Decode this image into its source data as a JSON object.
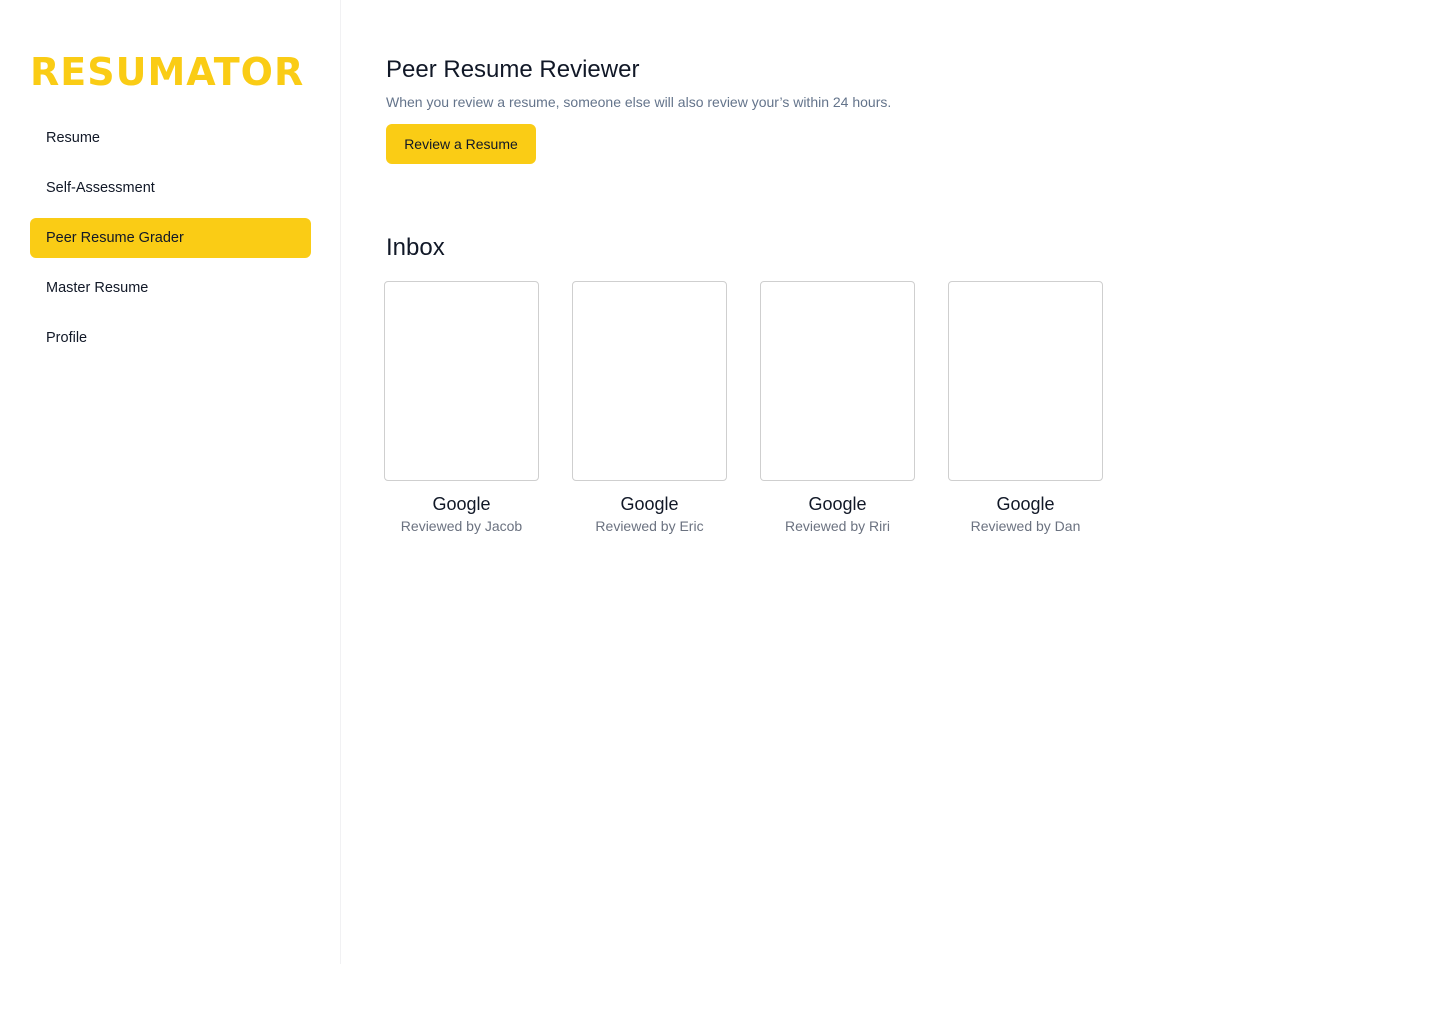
{
  "brand": {
    "logo_text": "RESUMATOR",
    "accent_color": "#facc15"
  },
  "sidebar": {
    "items": [
      {
        "label": "Resume",
        "active": false
      },
      {
        "label": "Self-Assessment",
        "active": false
      },
      {
        "label": "Peer Resume Grader",
        "active": true
      },
      {
        "label": "Master Resume",
        "active": false
      },
      {
        "label": "Profile",
        "active": false
      }
    ]
  },
  "header": {
    "title": "Peer Resume Reviewer",
    "subtitle": "When you review a resume, someone else will also review your’s within 24 hours.",
    "action_label": "Review a Resume"
  },
  "inbox": {
    "title": "Inbox",
    "cards": [
      {
        "company": "Google",
        "reviewer": "Reviewed by Jacob"
      },
      {
        "company": "Google",
        "reviewer": "Reviewed by Eric"
      },
      {
        "company": "Google",
        "reviewer": "Reviewed by Riri"
      },
      {
        "company": "Google",
        "reviewer": "Reviewed by Dan"
      }
    ]
  }
}
